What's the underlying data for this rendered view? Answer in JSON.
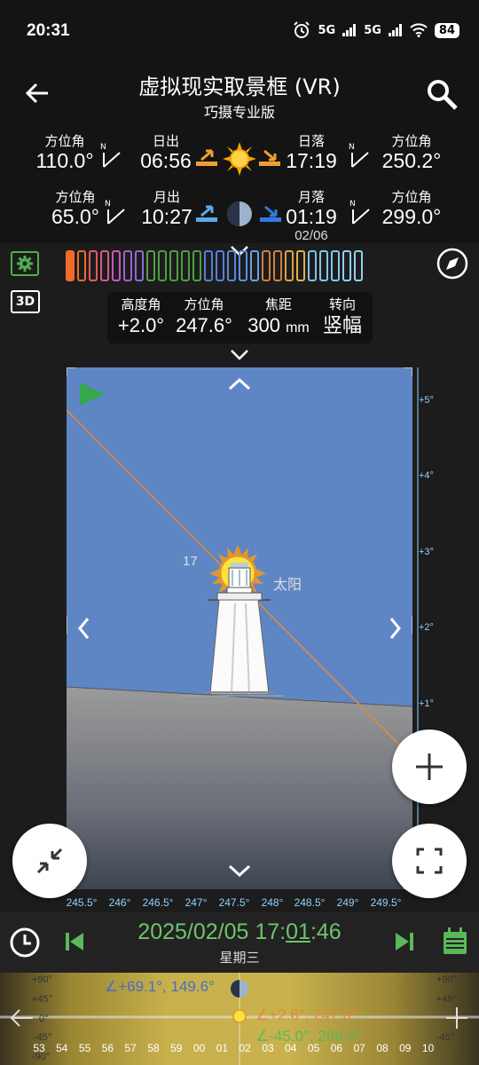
{
  "status": {
    "time": "20:31",
    "signal1": "5G",
    "signal2": "5G",
    "battery": "84"
  },
  "header": {
    "title": "虚拟现实取景框 (VR)",
    "subtitle": "巧摄专业版"
  },
  "sun_info": {
    "azimuth_label_left": "方位角",
    "azimuth_left": "110.0°",
    "rise_label": "日出",
    "rise_time": "06:56",
    "set_label": "日落",
    "set_time": "17:19",
    "azimuth_label_right": "方位角",
    "azimuth_right": "250.2°"
  },
  "moon_info": {
    "azimuth_label_left": "方位角",
    "azimuth_left": "65.0°",
    "rise_label": "月出",
    "rise_time": "10:27",
    "set_label": "月落",
    "set_time": "01:19",
    "set_date": "02/06",
    "azimuth_label_right": "方位角",
    "azimuth_right": "299.0°"
  },
  "colors": {
    "accent_green": "#4caf50",
    "colorbar": [
      "#ef6c2a",
      "#ef6c2a",
      "#e85a5a",
      "#d95a8a",
      "#c45ab8",
      "#9c62d0",
      "#8a6fd8",
      "#5c9a4a",
      "#4ca040",
      "#4ca040",
      "#4ca040",
      "#4ca040",
      "#5a7ed8",
      "#5a7ed8",
      "#5a86e0",
      "#5a90e8",
      "#6aa0e8",
      "#d08040",
      "#d08040",
      "#e0a040",
      "#e0b050",
      "#80c0e8",
      "#80c8ea",
      "#80c8ea",
      "#90d0ee",
      "#90d0ee"
    ]
  },
  "readout": {
    "altitude_label": "高度角",
    "altitude_value": "+2.0°",
    "azimuth_label": "方位角",
    "azimuth_value": "247.6°",
    "focal_label": "焦距",
    "focal_value": "300",
    "focal_unit": "mm",
    "orientation_label": "转向",
    "orientation_value": "竖幅"
  },
  "scene": {
    "sun_label": "太阳",
    "hour_label": "17"
  },
  "altitude_scale": [
    "+5°",
    "+4°",
    "+3°",
    "+2°",
    "+1°"
  ],
  "azimuth_scale": [
    "245.5°",
    "246°",
    "246.5°",
    "247°",
    "247.5°",
    "248°",
    "248.5°",
    "249°",
    "249.5°"
  ],
  "timebar": {
    "datetime_prefix": "2025/02/05 17:",
    "datetime_min": "01",
    "datetime_suffix": ":46",
    "weekday": "星期三"
  },
  "timeline": {
    "moon_row": "∠+69.1°, 149.6°",
    "sun_row": "∠+2.6°, 247.6°",
    "other_row": "∠-45.0°, 266.0°",
    "alt_labels": [
      "+90°",
      "+45°",
      "0°",
      "-45°",
      "-90°"
    ],
    "ticks": [
      "53",
      "54",
      "55",
      "56",
      "57",
      "58",
      "59",
      "00",
      "01",
      "02",
      "03",
      "04",
      "05",
      "06",
      "07",
      "08",
      "09",
      "10"
    ]
  }
}
